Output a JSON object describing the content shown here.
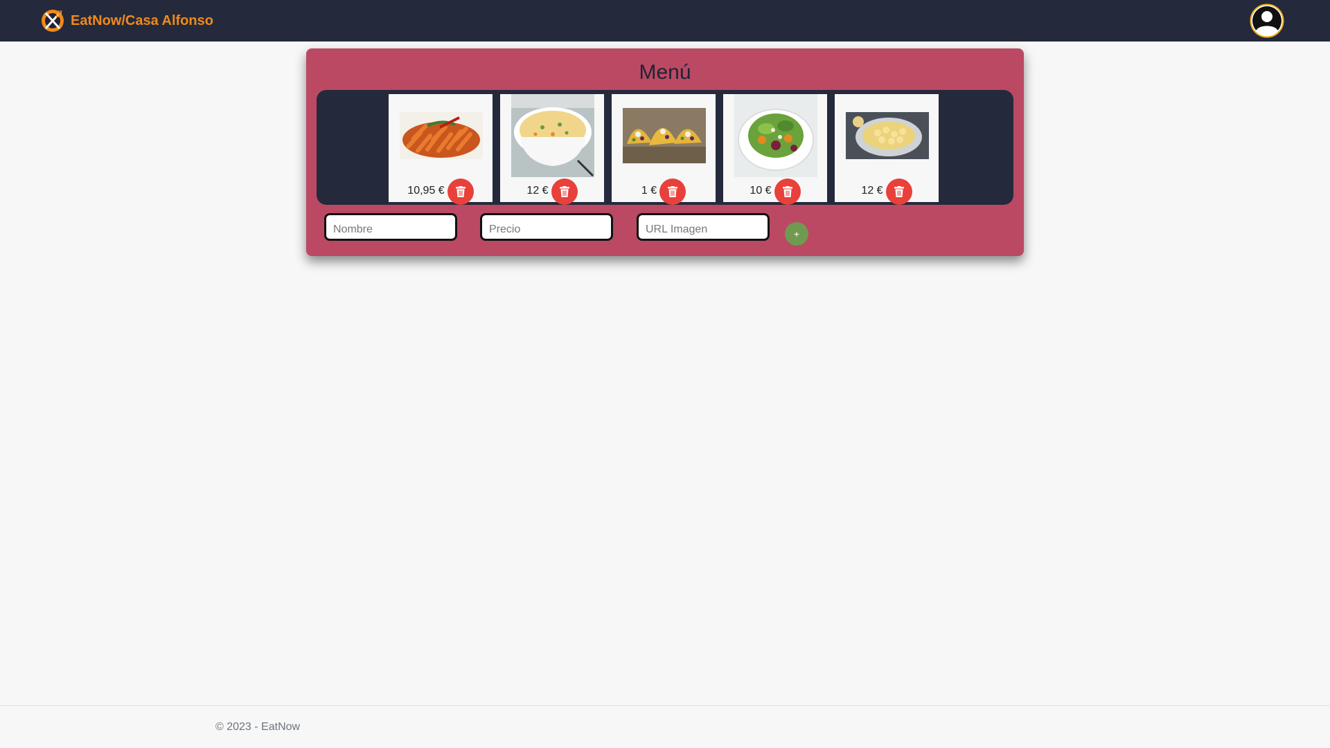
{
  "navbar": {
    "brand": "EatNow/Casa Alfonso",
    "logo_icon": "eatnow-logo-icon",
    "avatar_icon": "user-avatar-icon",
    "colors": {
      "background": "#242a3b",
      "brand": "#f08a1c"
    }
  },
  "menu": {
    "title": "Menú",
    "items": [
      {
        "image": "pasta-penne-image",
        "price": "10,95 €",
        "delete_icon": "trash-icon"
      },
      {
        "image": "soup-bowl-image",
        "price": "12 €",
        "delete_icon": "trash-icon"
      },
      {
        "image": "tacos-image",
        "price": "1 €",
        "delete_icon": "trash-icon"
      },
      {
        "image": "salad-image",
        "price": "10 €",
        "delete_icon": "trash-icon"
      },
      {
        "image": "mac-and-cheese-image",
        "price": "12 €",
        "delete_icon": "trash-icon"
      }
    ],
    "colors": {
      "panel": "#bb4963",
      "strip": "#242a3b",
      "delete": "#e8413b",
      "add": "#6f9a4f"
    }
  },
  "form": {
    "name_placeholder": "Nombre",
    "price_placeholder": "Precio",
    "image_url_placeholder": "URL Imagen",
    "add_label": "+"
  },
  "footer": {
    "text": "© 2023 - EatNow"
  }
}
